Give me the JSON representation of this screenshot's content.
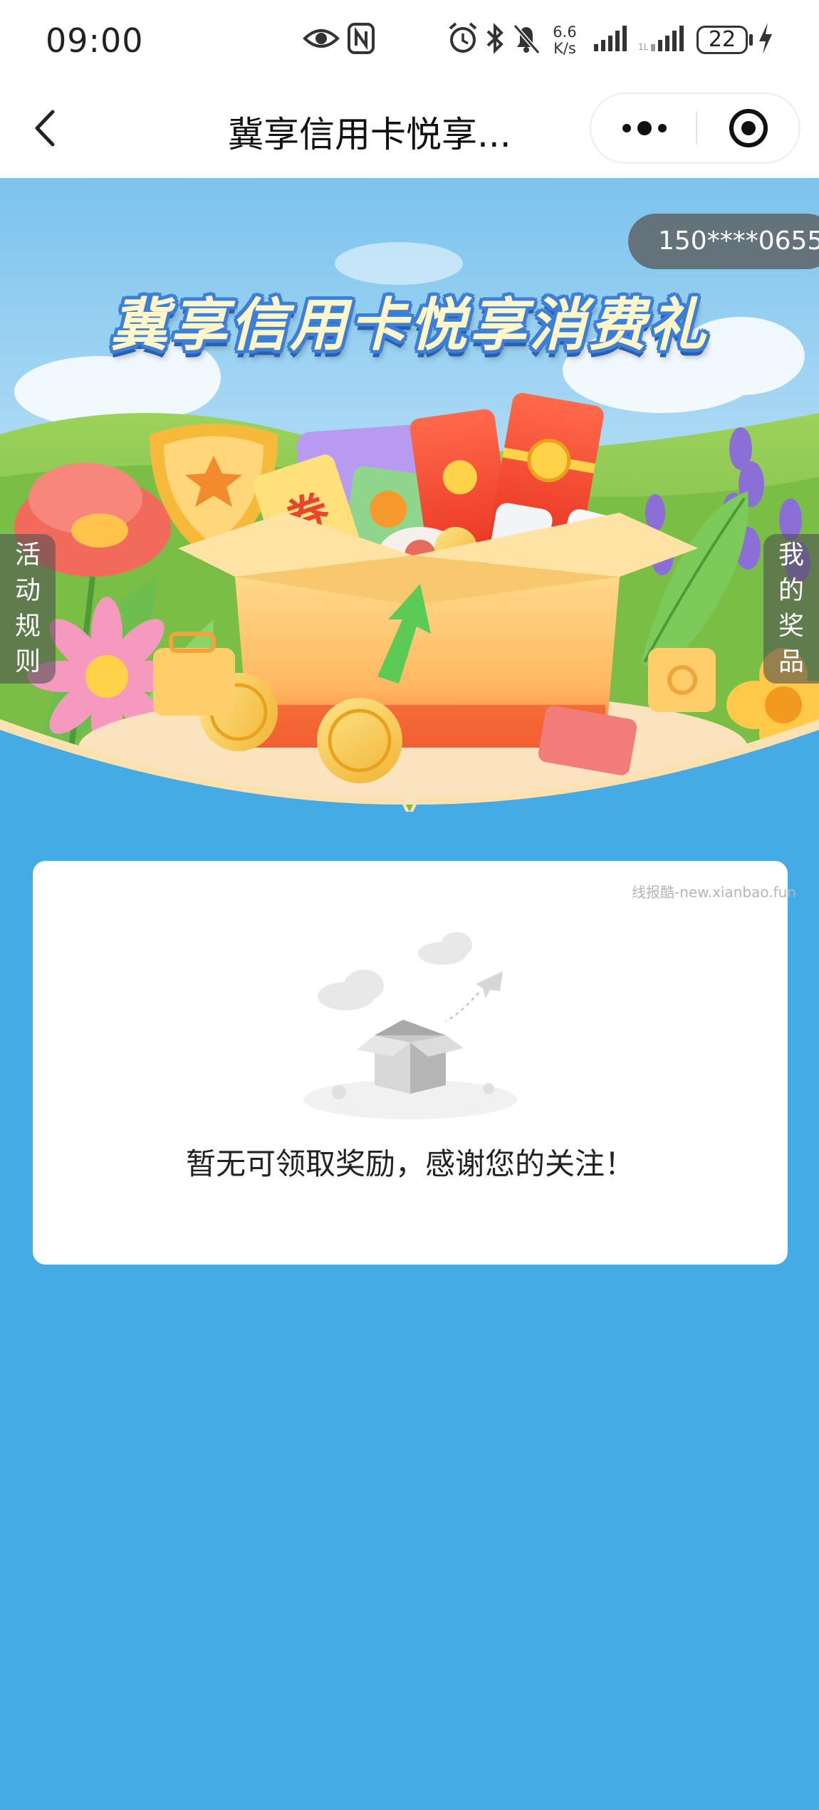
{
  "status_bar": {
    "time": "09:00",
    "net_speed_value": "6.6",
    "net_speed_unit": "K/s",
    "battery": "22",
    "icons": [
      "eye-icon",
      "nfc-icon",
      "alarm-icon",
      "bluetooth-icon",
      "mute-bell-icon",
      "signal-icon",
      "signal-icon",
      "charging-icon"
    ]
  },
  "nav": {
    "title": "冀享信用卡悦享...",
    "icons": [
      "back-arrow-icon",
      "more-dots-icon",
      "close-target-icon"
    ]
  },
  "banner": {
    "phone": "150****0655",
    "title": "冀享信用卡悦享消费礼",
    "coupon_char": "券",
    "left_tab": [
      "活",
      "动",
      "规",
      "则"
    ],
    "right_tab": [
      "我",
      "的",
      "奖",
      "品"
    ]
  },
  "card": {
    "watermark": "线报酷-new.xianbao.fun",
    "empty_message": "暂无可领取奖励，感谢您的关注！",
    "icon": "empty-box-icon"
  },
  "colors": {
    "page_background": "#45ABE4",
    "title_outline": "#3E7FD6",
    "title_fill": "#FFF6C9"
  }
}
